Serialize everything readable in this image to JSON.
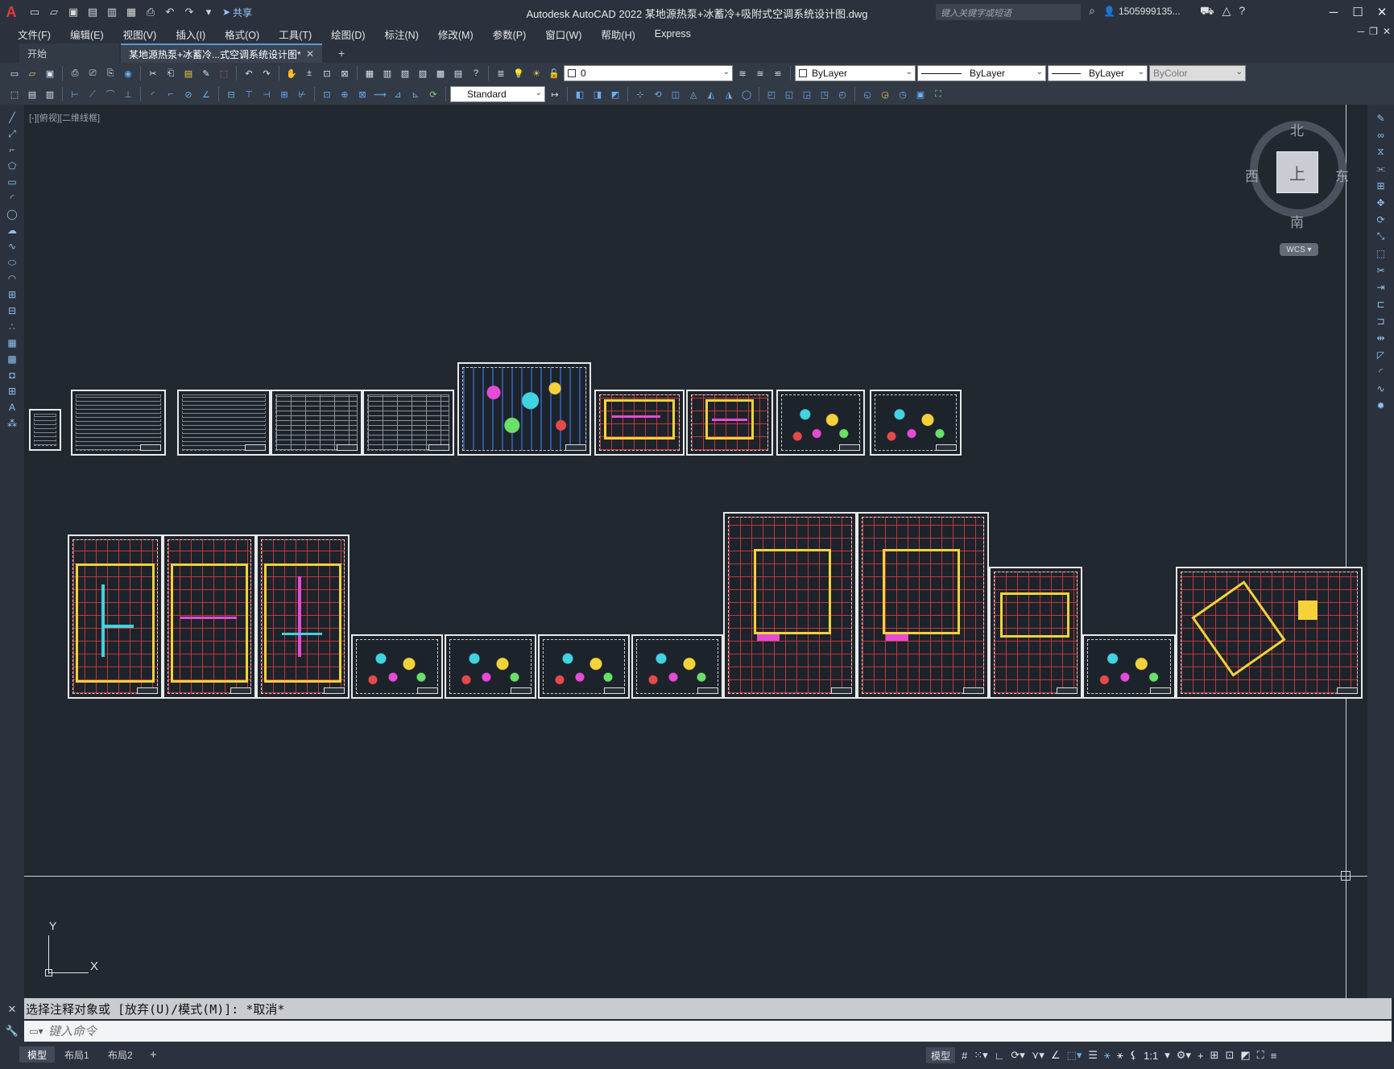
{
  "app": {
    "logo": "A",
    "title": "Autodesk AutoCAD 2022    某地源热泵+冰蓄冷+吸附式空调系统设计图.dwg",
    "share_label": "共享",
    "search_placeholder": "键入关键字或短语",
    "user": "1505999135...",
    "window_controls": [
      "─",
      "☐",
      "✕"
    ]
  },
  "menu": {
    "items": [
      "文件(F)",
      "编辑(E)",
      "视图(V)",
      "插入(I)",
      "格式(O)",
      "工具(T)",
      "绘图(D)",
      "标注(N)",
      "修改(M)",
      "参数(P)",
      "窗口(W)",
      "帮助(H)",
      "Express"
    ]
  },
  "tabs": {
    "start": "开始",
    "file": "某地源热泵+冰蓄冷...式空调系统设计图*",
    "close": "✕",
    "add": "+"
  },
  "toolbar": {
    "layer": "0",
    "color": "ByLayer",
    "linetype": "ByLayer",
    "lineweight": "ByLayer",
    "plotstyle": "ByColor",
    "textstyle": "Standard"
  },
  "viewport": {
    "label": "[-][俯视][二维线框]",
    "compass": {
      "north": "北",
      "south": "南",
      "east": "东",
      "west": "西"
    },
    "cube_face": "上",
    "wcs": "WCS ▾",
    "ucs_x": "X",
    "ucs_y": "Y"
  },
  "command": {
    "history": "选择注释对象或 [放弃(U)/模式(M)]: *取消*",
    "placeholder": "键入命令"
  },
  "status": {
    "model_tab": "模型",
    "layout1": "布局1",
    "layout2": "布局2",
    "add": "+",
    "mode": "模型",
    "scale": "1:1"
  }
}
